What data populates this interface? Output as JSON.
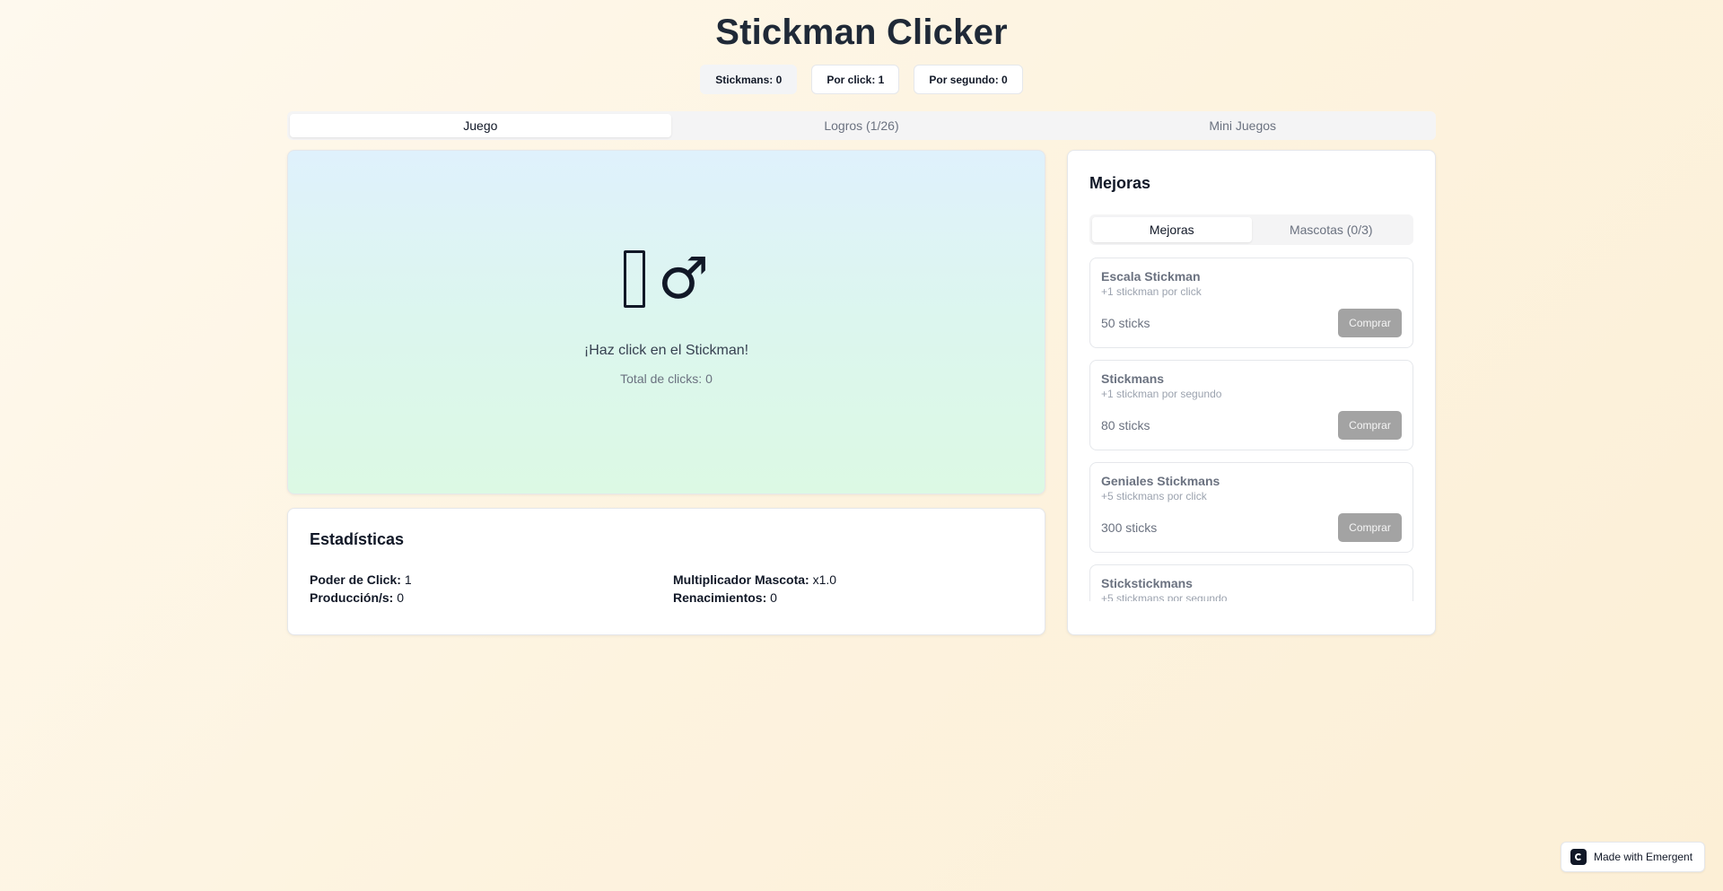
{
  "header": {
    "title": "Stickman Clicker",
    "stats": {
      "stickmans": "Stickmans: 0",
      "per_click": "Por click: 1",
      "per_second": "Por segundo: 0"
    }
  },
  "main_tabs": [
    {
      "label": "Juego",
      "active": true
    },
    {
      "label": "Logros (1/26)",
      "active": false
    },
    {
      "label": "Mini Juegos",
      "active": false
    }
  ],
  "game": {
    "stickman_glyph": "♂",
    "prompt": "¡Haz click en el Stickman!",
    "total_clicks": "Total de clicks: 0"
  },
  "stats_panel": {
    "title": "Estadísticas",
    "items": [
      {
        "label": "Poder de Click:",
        "value": "1"
      },
      {
        "label": "Multiplicador Mascota:",
        "value": "x1.0"
      },
      {
        "label": "Producción/s:",
        "value": "0"
      },
      {
        "label": "Renacimientos:",
        "value": "0"
      }
    ]
  },
  "upgrades_panel": {
    "title": "Mejoras",
    "tabs": [
      {
        "label": "Mejoras",
        "active": true
      },
      {
        "label": "Mascotas (0/3)",
        "active": false
      }
    ],
    "items": [
      {
        "name": "Escala Stickman",
        "desc": "+1 stickman por click",
        "price": "50 sticks",
        "button": "Comprar"
      },
      {
        "name": "Stickmans",
        "desc": "+1 stickman por segundo",
        "price": "80 sticks",
        "button": "Comprar"
      },
      {
        "name": "Geniales Stickmans",
        "desc": "+5 stickmans por click",
        "price": "300 sticks",
        "button": "Comprar"
      },
      {
        "name": "Stickstickmans",
        "desc": "+5 stickmans por segundo",
        "price": "",
        "button": ""
      }
    ]
  },
  "badge": {
    "label": "Made with Emergent"
  },
  "colors": {
    "buy_button_disabled": "#a3a3a3",
    "game_gradient_top": "#dff1fc",
    "game_gradient_bottom": "#dcf9e4"
  }
}
